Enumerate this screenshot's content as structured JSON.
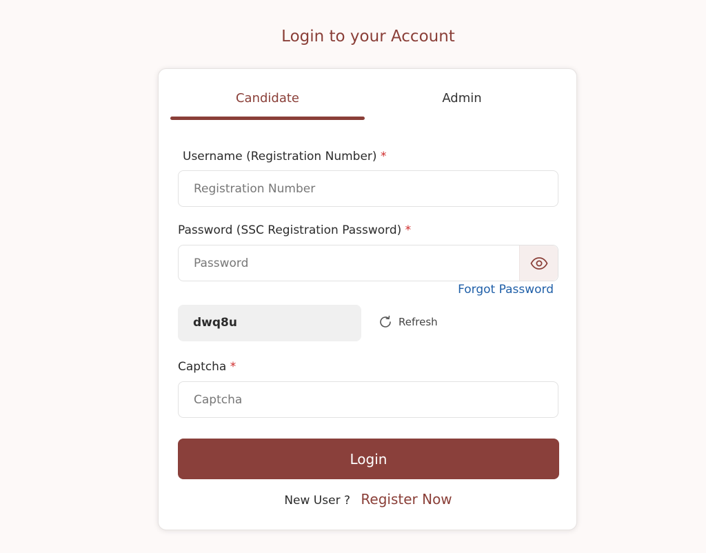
{
  "page": {
    "title": "Login to your Account"
  },
  "tabs": [
    {
      "label": "Candidate",
      "active": true
    },
    {
      "label": "Admin",
      "active": false
    }
  ],
  "form": {
    "username": {
      "label": "Username (Registration Number)",
      "required_mark": "*",
      "placeholder": "Registration Number",
      "value": ""
    },
    "password": {
      "label": "Password (SSC Registration Password)",
      "required_mark": "*",
      "placeholder": "Password",
      "value": "",
      "toggle_icon": "eye-icon"
    },
    "forgot_password": "Forgot Password",
    "captcha_code": "dwq8u",
    "refresh_label": "Refresh",
    "refresh_icon": "refresh-icon",
    "captcha": {
      "label": "Captcha",
      "required_mark": "*",
      "placeholder": "Captcha",
      "value": ""
    },
    "login_label": "Login",
    "new_user_text": "New User ?",
    "register_label": "Register Now"
  },
  "colors": {
    "accent": "#8a3f38",
    "link": "#1f5fa8",
    "required": "#cf2b2b",
    "background": "#fdf9f8"
  }
}
